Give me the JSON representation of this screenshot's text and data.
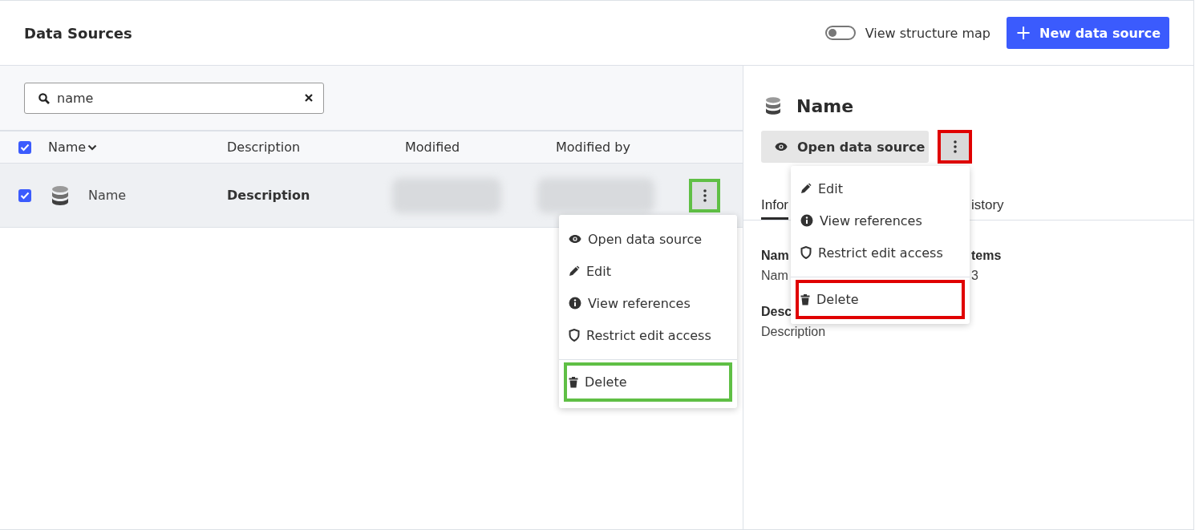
{
  "header": {
    "title": "Data Sources",
    "toggle": {
      "label": "View structure map",
      "on": false
    },
    "new_button": {
      "icon": "+",
      "label": "New data source"
    }
  },
  "search": {
    "value": "name"
  },
  "table": {
    "select_all": true,
    "columns": [
      {
        "label": "Name",
        "sorted": true
      },
      {
        "label": "Description",
        "sorted": false
      },
      {
        "label": "Modified",
        "sorted": false
      },
      {
        "label": "Modified by",
        "sorted": false
      }
    ],
    "rows": [
      {
        "selected": true,
        "name": "Name",
        "description": "Description",
        "modified": {
          "kind": "blurred"
        },
        "modified_by": {
          "kind": "blurred"
        },
        "more_button": {
          "color": "#5fbf45"
        }
      }
    ]
  },
  "row_menu": {
    "items": [
      {
        "kind": "open",
        "label": "Open data source"
      },
      {
        "kind": "edit",
        "label": "Edit"
      },
      {
        "kind": "references",
        "label": "View references"
      },
      {
        "kind": "restrict",
        "label": "Restrict edit access"
      },
      {
        "kind": "delete",
        "label": "Delete",
        "color": "#5fbf45"
      }
    ]
  },
  "detail": {
    "title": "Name",
    "open_button": "Open data source",
    "more_button": {
      "color": "#e00000"
    },
    "menu": {
      "items": [
        {
          "kind": "edit",
          "label": "Edit"
        },
        {
          "kind": "references",
          "label": "View references"
        },
        {
          "kind": "restrict",
          "label": "Restrict edit access"
        },
        {
          "kind": "delete",
          "label": "Delete",
          "color": "#e00000"
        }
      ]
    },
    "tabs": [
      {
        "label": "Infor",
        "selected": true
      },
      {
        "label": "istory",
        "selected": false
      }
    ],
    "fields": [
      {
        "label": "Nam",
        "value": "Nam"
      },
      {
        "label": "tems",
        "value": "3"
      },
      {
        "label": "Desc",
        "value": "Description"
      }
    ]
  }
}
